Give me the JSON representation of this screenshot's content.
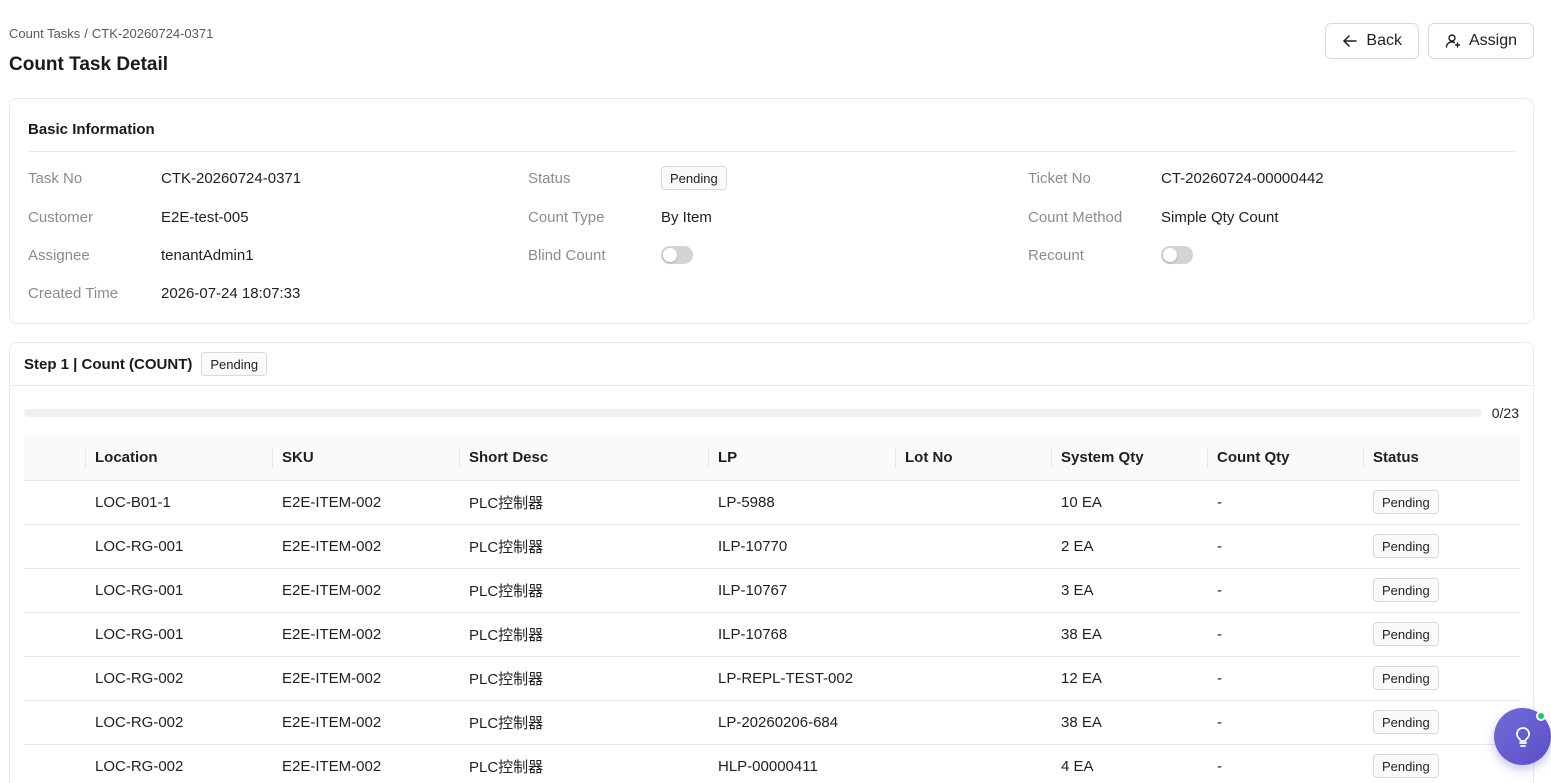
{
  "breadcrumb": {
    "parent": "Count Tasks",
    "separator": "/",
    "current": "CTK-20260724-0371"
  },
  "page_title": "Count Task Detail",
  "actions": {
    "back_label": "Back",
    "assign_label": "Assign"
  },
  "basic_info": {
    "title": "Basic Information",
    "task_no_label": "Task No",
    "task_no": "CTK-20260724-0371",
    "status_label": "Status",
    "status": "Pending",
    "ticket_no_label": "Ticket No",
    "ticket_no": "CT-20260724-00000442",
    "customer_label": "Customer",
    "customer": "E2E-test-005",
    "count_type_label": "Count Type",
    "count_type": "By Item",
    "count_method_label": "Count Method",
    "count_method": "Simple Qty Count",
    "assignee_label": "Assignee",
    "assignee": "tenantAdmin1",
    "blind_count_label": "Blind Count",
    "blind_count_on": false,
    "recount_label": "Recount",
    "recount_on": false,
    "created_time_label": "Created Time",
    "created_time": "2026-07-24 18:07:33"
  },
  "step": {
    "title": "Step 1 | Count (COUNT)",
    "status": "Pending",
    "progress_text": "0/23",
    "progress_fraction": 0
  },
  "table": {
    "headers": {
      "location": "Location",
      "sku": "SKU",
      "short_desc": "Short Desc",
      "lp": "LP",
      "lot_no": "Lot No",
      "system_qty": "System Qty",
      "count_qty": "Count Qty",
      "status": "Status"
    },
    "rows": [
      {
        "location": "LOC-B01-1",
        "sku": "E2E-ITEM-002",
        "short_desc": "PLC控制器",
        "lp": "LP-5988",
        "lot_no": "",
        "system_qty": "10 EA",
        "count_qty": "-",
        "status": "Pending"
      },
      {
        "location": "LOC-RG-001",
        "sku": "E2E-ITEM-002",
        "short_desc": "PLC控制器",
        "lp": "ILP-10770",
        "lot_no": "",
        "system_qty": "2 EA",
        "count_qty": "-",
        "status": "Pending"
      },
      {
        "location": "LOC-RG-001",
        "sku": "E2E-ITEM-002",
        "short_desc": "PLC控制器",
        "lp": "ILP-10767",
        "lot_no": "",
        "system_qty": "3 EA",
        "count_qty": "-",
        "status": "Pending"
      },
      {
        "location": "LOC-RG-001",
        "sku": "E2E-ITEM-002",
        "short_desc": "PLC控制器",
        "lp": "ILP-10768",
        "lot_no": "",
        "system_qty": "38 EA",
        "count_qty": "-",
        "status": "Pending"
      },
      {
        "location": "LOC-RG-002",
        "sku": "E2E-ITEM-002",
        "short_desc": "PLC控制器",
        "lp": "LP-REPL-TEST-002",
        "lot_no": "",
        "system_qty": "12 EA",
        "count_qty": "-",
        "status": "Pending"
      },
      {
        "location": "LOC-RG-002",
        "sku": "E2E-ITEM-002",
        "short_desc": "PLC控制器",
        "lp": "LP-20260206-684",
        "lot_no": "",
        "system_qty": "38 EA",
        "count_qty": "-",
        "status": "Pending"
      },
      {
        "location": "LOC-RG-002",
        "sku": "E2E-ITEM-002",
        "short_desc": "PLC控制器",
        "lp": "HLP-00000411",
        "lot_no": "",
        "system_qty": "4 EA",
        "count_qty": "-",
        "status": "Pending"
      }
    ]
  },
  "icons": {
    "back": "arrow-left-icon",
    "assign": "user-plus-icon",
    "assistant": "lightbulb-icon"
  },
  "colors": {
    "accent": "#6b5bd6",
    "fab_online_dot": "#22c55e"
  }
}
